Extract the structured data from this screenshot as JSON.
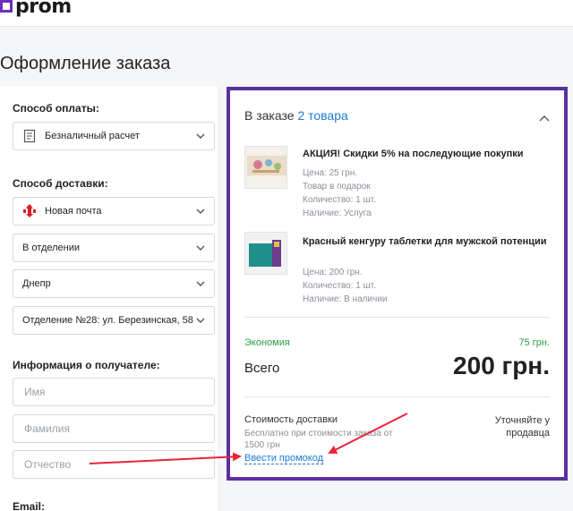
{
  "header": {
    "logo_text": "prom"
  },
  "page": {
    "title": "Оформление заказа"
  },
  "form": {
    "payment": {
      "label": "Способ оплаты:",
      "selected": "Безналичный расчет",
      "icon": "invoice-icon"
    },
    "delivery": {
      "label": "Способ доставки:",
      "carrier": "Новая почта",
      "carrier_icon": "nova-poshta-icon",
      "method": "В отделении",
      "city": "Днепр",
      "branch": "Отделение №28: ул. Березинская, 58"
    },
    "recipient": {
      "label": "Информация о получателе:",
      "first_name_placeholder": "Имя",
      "last_name_placeholder": "Фамилия",
      "middle_name_placeholder": "Отчество"
    },
    "email": {
      "label": "Email:"
    }
  },
  "order": {
    "heading": "В заказе",
    "count_text": "2 товара",
    "items": [
      {
        "title": "АКЦИЯ! Скидки 5% на последующие покупки",
        "meta": [
          "Цена: 25 грн.",
          "Товар в подарок",
          "Количество: 1 шт.",
          "Наличие: Услуга"
        ]
      },
      {
        "title": "Красный кенгуру таблетки для мужской потенции",
        "meta": [
          "Цена: 200 грн.",
          "Количество: 1 шт.",
          "Наличие: В наличии"
        ]
      }
    ],
    "savings_label": "Экономия",
    "savings_value": "75 грн.",
    "total_label": "Всего",
    "total_value": "200 грн.",
    "delivery_label": "Стоимость доставки",
    "delivery_note": "Бесплатно при стоимости заказа от 1500 грн",
    "delivery_right": "Уточняйте у продавца",
    "promo_link": "Ввести промокод"
  },
  "colors": {
    "accent_purple": "#5b2fa0",
    "link_blue": "#1e7ad6",
    "savings_green": "#2ea043",
    "arrow_red": "#e8243a"
  }
}
